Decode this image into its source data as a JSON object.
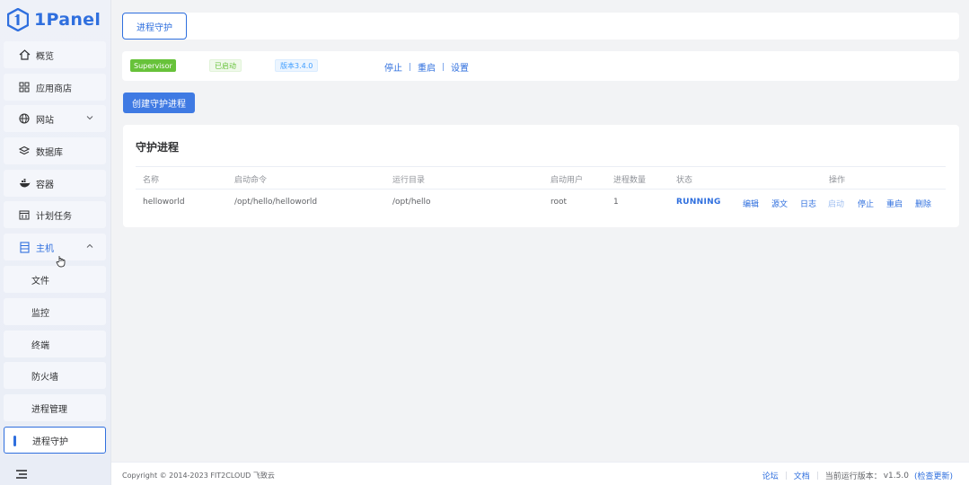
{
  "brand": {
    "name": "1Panel",
    "color": "#2f6fde"
  },
  "sidebar": {
    "items": [
      {
        "label": "概览",
        "icon": "home-icon"
      },
      {
        "label": "应用商店",
        "icon": "grid-icon"
      },
      {
        "label": "网站",
        "icon": "globe-icon",
        "expandable": true
      },
      {
        "label": "数据库",
        "icon": "database-icon"
      },
      {
        "label": "容器",
        "icon": "whale-icon"
      },
      {
        "label": "计划任务",
        "icon": "calendar-icon"
      },
      {
        "label": "主机",
        "icon": "server-icon",
        "expanded": true
      }
    ],
    "host_sub": [
      {
        "label": "文件"
      },
      {
        "label": "监控"
      },
      {
        "label": "终端"
      },
      {
        "label": "防火墙"
      },
      {
        "label": "进程管理"
      },
      {
        "label": "进程守护",
        "active": true
      }
    ]
  },
  "tabs": [
    {
      "label": "进程守护",
      "active": true
    }
  ],
  "status": {
    "service": "Supervisor",
    "state": "已启动",
    "version": "版本3.4.0",
    "actions": [
      "停止",
      "重启",
      "设置"
    ]
  },
  "create_button": "创建守护进程",
  "table": {
    "title": "守护进程",
    "columns": [
      "名称",
      "启动命令",
      "运行目录",
      "启动用户",
      "进程数量",
      "状态",
      "操作"
    ],
    "rows": [
      {
        "name": "helloworld",
        "command": "/opt/hello/helloworld",
        "dir": "/opt/hello",
        "user": "root",
        "count": "1",
        "status": "RUNNING",
        "ops": [
          "编辑",
          "源文",
          "日志",
          "启动",
          "停止",
          "重启",
          "删除"
        ]
      }
    ]
  },
  "footer": {
    "copyright": "Copyright © 2014-2023 FIT2CLOUD 飞致云",
    "forum": "论坛",
    "docs": "文档",
    "version_label": "当前运行版本：",
    "version": "v1.5.0",
    "check_update": "(检查更新)"
  }
}
